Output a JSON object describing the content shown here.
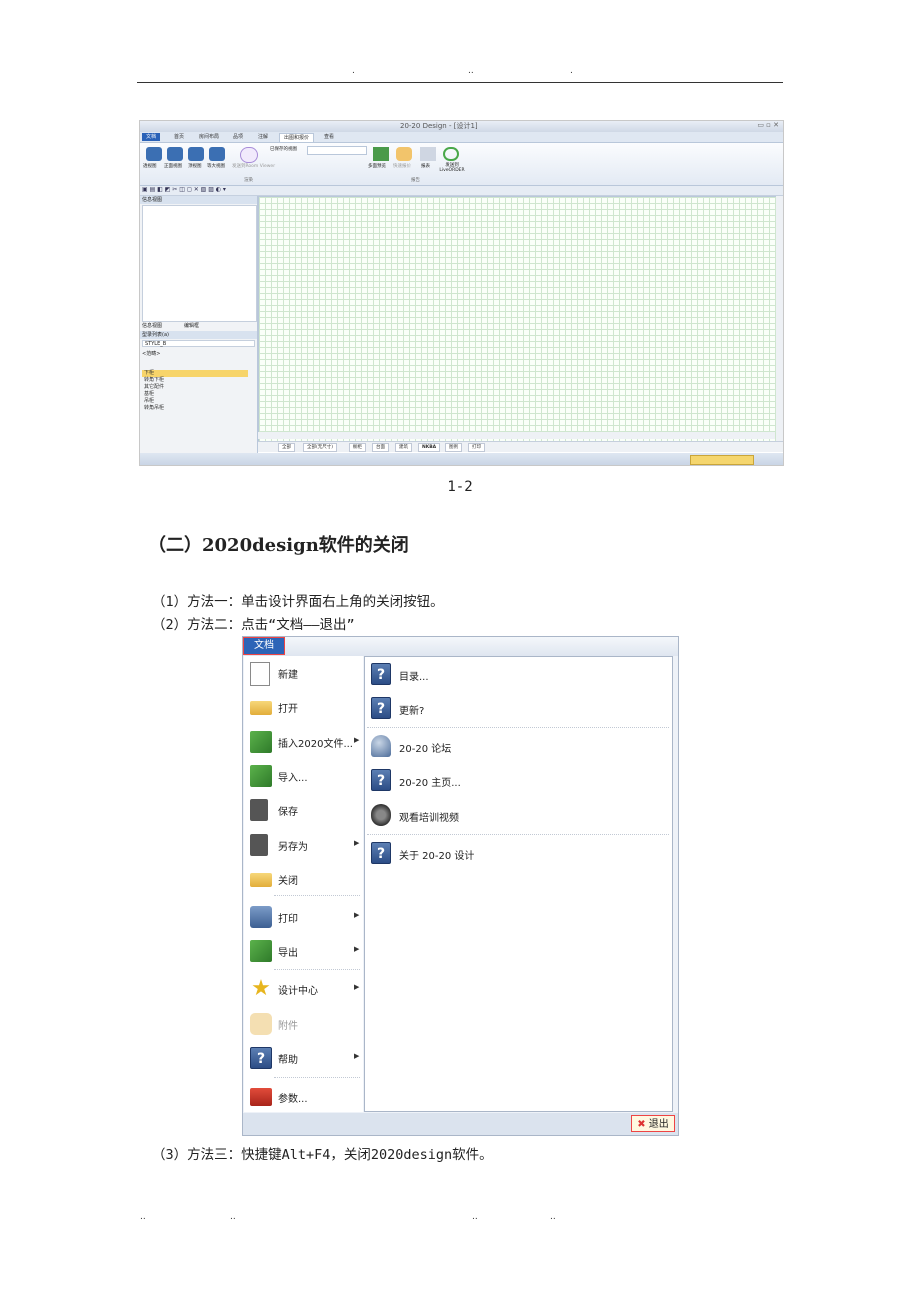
{
  "header_marks": [
    ".",
    "..",
    "."
  ],
  "footer_marks": [
    "..",
    "..",
    "..",
    ".."
  ],
  "screenshot1": {
    "window_title": "20-20 Design - [设计1]",
    "ribbon_tabs": [
      "文档",
      "首页",
      "房间布局",
      "品项",
      "注解",
      "出图和报价",
      "查看"
    ],
    "ribbon_buttons": [
      "透视图",
      "正面视图",
      "顶视图",
      "等大视图",
      "发送到Room Viewer"
    ],
    "group_labels": [
      "渲染",
      "报告"
    ],
    "saved_views_label": "已保存的视图",
    "report_buttons": [
      "多面预览",
      "快速报价",
      "报表",
      "发送到 LiveORDER"
    ],
    "info_panel_title": "信息视图",
    "info_tabs": [
      "信息视图",
      "编辑框"
    ],
    "catalog_panel_title": "型录列表(a)",
    "catalog_select": "STYLE_B",
    "catalog_filter": "<范畴>",
    "catalog_items": [
      "下柜",
      "转角下柜",
      "其它配件",
      "基柜",
      "吊柜",
      "转角吊柜"
    ],
    "bottom_tabs": [
      "全部",
      "全部(无尺寸)",
      "橱柜",
      "台面",
      "建筑",
      "NKBA",
      "图例",
      "打印"
    ]
  },
  "caption": "1-2",
  "section_heading": "（二）2020design软件的关闭",
  "paragraphs": {
    "p1": "（1）方法一：单击设计界面右上角的关闭按钮。",
    "p2": "（2）方法二：点击“文档——退出”",
    "p3": "（3）方法三：快捷键Alt+F4，关闭2020design软件。"
  },
  "menu": {
    "file_tab": "文档",
    "left_items": [
      {
        "label": "新建",
        "icon": "new-document-icon"
      },
      {
        "label": "打开",
        "icon": "open-folder-icon"
      },
      {
        "label": "插入2020文件...",
        "icon": "insert-file-icon"
      },
      {
        "label": "导入...",
        "icon": "import-icon"
      },
      {
        "label": "保存",
        "icon": "save-disk-icon"
      },
      {
        "label": "另存为",
        "icon": "save-as-icon"
      },
      {
        "label": "关闭",
        "icon": "close-folder-icon"
      },
      {
        "label": "打印",
        "icon": "printer-icon"
      },
      {
        "label": "导出",
        "icon": "export-icon"
      },
      {
        "label": "设计中心",
        "icon": "star-icon"
      },
      {
        "label": "附件",
        "icon": "puzzle-icon"
      },
      {
        "label": "帮助",
        "icon": "help-icon"
      },
      {
        "label": "参数...",
        "icon": "toolbox-icon"
      }
    ],
    "right_items": [
      {
        "label": "目录...",
        "icon": "help-icon"
      },
      {
        "label": "更新?",
        "icon": "help-icon"
      },
      {
        "label": "20-20 论坛",
        "icon": "users-icon"
      },
      {
        "label": "20-20 主页...",
        "icon": "help-icon"
      },
      {
        "label": "观看培训视频",
        "icon": "film-reel-icon"
      },
      {
        "label": "关于 20-20 设计",
        "icon": "help-icon"
      }
    ],
    "exit_label": "退出"
  }
}
